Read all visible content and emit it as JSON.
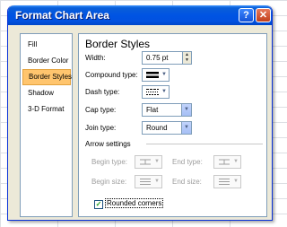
{
  "window": {
    "title": "Format Chart Area",
    "help_label": "?",
    "close_label": "✕"
  },
  "nav": {
    "items": [
      "Fill",
      "Border Color",
      "Border Styles",
      "Shadow",
      "3-D Format"
    ],
    "selected": "Border Styles"
  },
  "panel": {
    "heading": "Border Styles",
    "width": {
      "label": "Width:",
      "value": "0.75 pt"
    },
    "compound_type": {
      "label": "Compound type:"
    },
    "dash_type": {
      "label": "Dash type:"
    },
    "cap_type": {
      "label": "Cap type:",
      "value": "Flat"
    },
    "join_type": {
      "label": "Join type:",
      "value": "Round"
    },
    "arrow_settings": {
      "title": "Arrow settings",
      "begin_type": "Begin type:",
      "end_type": "End type:",
      "begin_size": "Begin size:",
      "end_size": "End size:"
    },
    "rounded_corners": {
      "label": "Rounded corners",
      "checked": true,
      "check_glyph": "✓"
    }
  },
  "icons": {
    "dropdown": "▼",
    "spin_up": "▲",
    "spin_down": "▼"
  },
  "colors": {
    "selection": "#ffc56e",
    "titlebar": "#0054e3",
    "dialog": "#ece9d8"
  }
}
